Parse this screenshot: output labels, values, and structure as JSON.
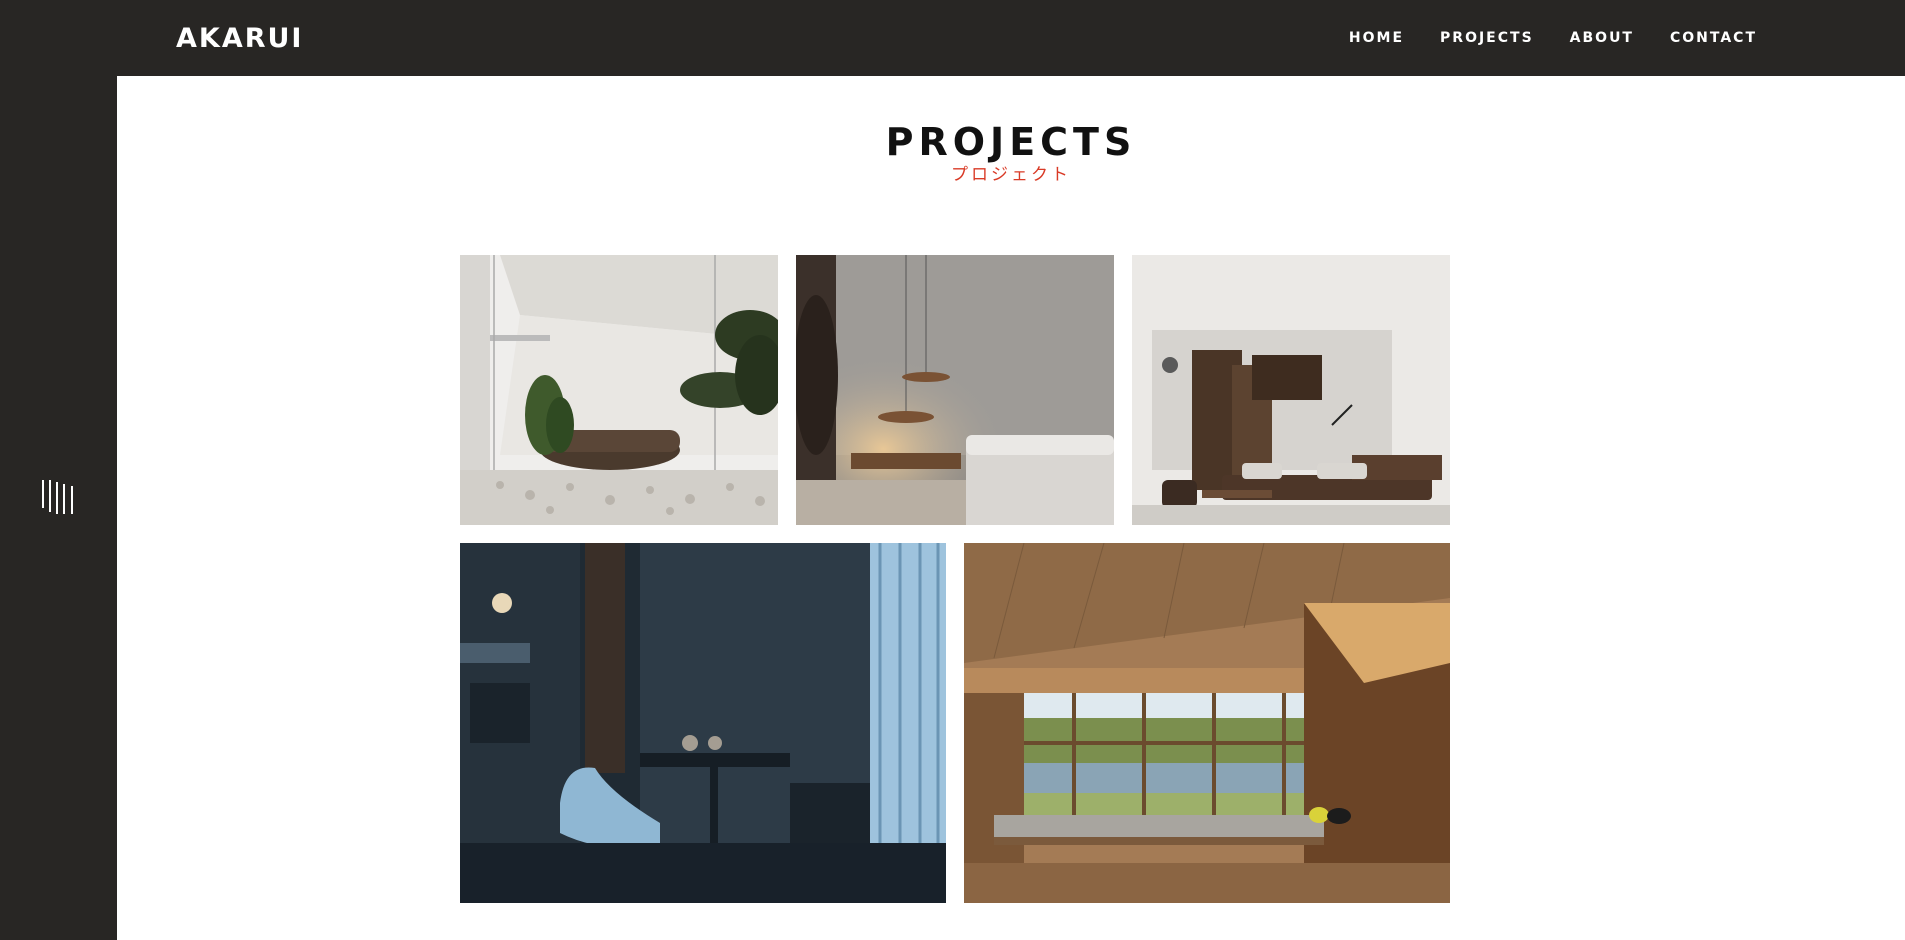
{
  "header": {
    "logo": "AKARUI",
    "nav": [
      "HOME",
      "PROJECTS",
      "ABOUT",
      "CONTACT"
    ]
  },
  "sidebar": {
    "menu_icon": "menu-lines-icon"
  },
  "page": {
    "title": "PROJECTS",
    "subtitle": "プロジェクト"
  },
  "colors": {
    "dark": "#282624",
    "accent": "#d93a26",
    "background": "#ffffff"
  }
}
